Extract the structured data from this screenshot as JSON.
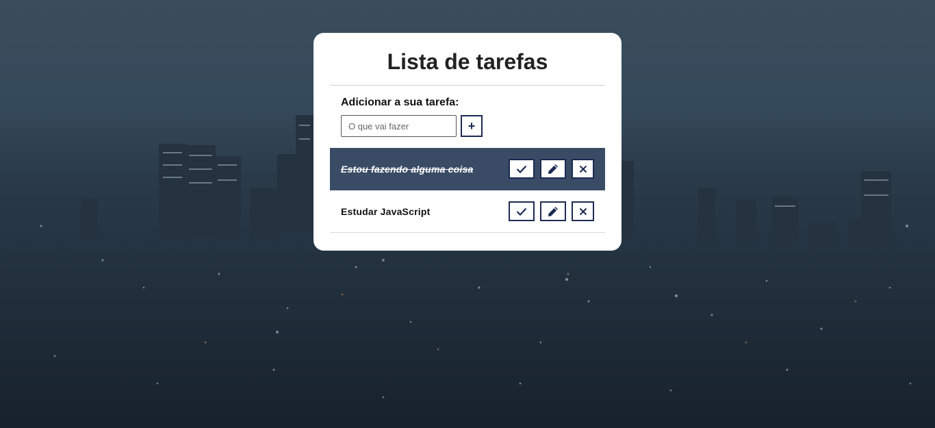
{
  "app": {
    "title": "Lista de tarefas"
  },
  "add_form": {
    "label": "Adicionar a sua tarefa:",
    "placeholder": "O que vai fazer",
    "value": "",
    "add_button_label": "+"
  },
  "todos": [
    {
      "text": "Estou fazendo alguma coisa",
      "done": true
    },
    {
      "text": "Estudar JavaScript",
      "done": false
    }
  ],
  "icons": {
    "done": "check-icon",
    "edit": "pencil-icon",
    "remove": "close-icon"
  },
  "colors": {
    "accent": "#1b2a52",
    "done_row": "#3a4b66",
    "card": "#ffffff"
  }
}
